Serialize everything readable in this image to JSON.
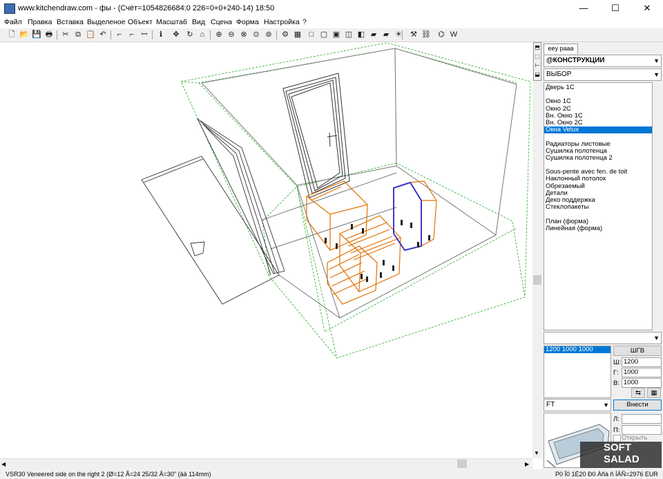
{
  "window": {
    "title": "www.kitchendraw.com - фы - (Счёт=1054826684:0 226=0+0+240-14) 18:50",
    "minimize": "—",
    "maximize": "☐",
    "close": "✕"
  },
  "menu": [
    "Файл",
    "Правка",
    "Вставка",
    "Выделеное",
    "Объект",
    "Масштаб",
    "Вид",
    "Сцена",
    "Форма",
    "Настройка",
    "?"
  ],
  "toolbar_icons": [
    "new-icon",
    "open-icon",
    "save-icon",
    "print-icon",
    "cut-icon",
    "copy-icon",
    "paste-icon",
    "undo-icon",
    "stairs-icon",
    "stairs-edit-icon",
    "measure-icon",
    "info-icon",
    "move-icon",
    "rotate-icon",
    "align-icon",
    "zoom-in-icon",
    "zoom-out-icon",
    "zoom-fit-icon",
    "zoom-window-icon",
    "zoom-prev-icon",
    "render-icon",
    "film-icon",
    "box-icon",
    "plan-icon",
    "view-3d-icon",
    "perspective-icon",
    "iso-icon",
    "camera-icon",
    "camera-multi-icon",
    "light-icon",
    "tools-icon",
    "walk-icon",
    "path-icon",
    "w-icon"
  ],
  "toolbar_glyphs": [
    "🗋",
    "📂",
    "💾",
    "🖶",
    "✂",
    "⧉",
    "📋",
    "↶",
    "⌐",
    "⌐",
    "ꟷ",
    "ℹ",
    "✥",
    "↻",
    "⌂",
    "⊕",
    "⊖",
    "⊗",
    "⊙",
    "⊚",
    "⚙",
    "▦",
    "□",
    "▢",
    "▣",
    "◫",
    "◧",
    "▰",
    "▰",
    "☀",
    "⚒",
    "⛓",
    "⌬",
    "W"
  ],
  "side_tabs": {
    "active_label": "ееу рааа"
  },
  "panel": {
    "category": "@КОНСТРУКЦИИ",
    "filter": "ВЫБОР",
    "items": [
      "Дверь 1С",
      "",
      "Окно 1С",
      "Окно 2С",
      "Вн. Окно 1С",
      "Вн. Окно 2С",
      "Окна Velux",
      "",
      "Радиаторы листовые",
      "Сушилка полотенца",
      "Сушилка полотенца 2",
      "",
      "Sous-pente avec fen. de toit",
      "Наклонный потолок",
      "Обрезаемый",
      "Детали",
      "Деко поддержка",
      "Стеклопакеты",
      "",
      "План (форма)",
      "Линейная (форма)"
    ],
    "selected_index": 6,
    "dims_list": [
      "1200 1000 1000"
    ],
    "dims_button": "ШГВ",
    "w_label": "Ш:",
    "w_value": "1200",
    "d_label": "Г:",
    "d_value": "1000",
    "h_label": "В:",
    "h_value": "1000",
    "finish_combo": "FT",
    "insert_button": "Внести",
    "l_label": "Л:",
    "p_label": "П:",
    "open_checkbox": "Открыть"
  },
  "status": {
    "left": "VSR30  Veneered side on the right 2  (Ø=12 Ã=24 25/32 Â=30\" (ää 114mm)",
    "right": "P0 Î0 1É20 Ð0 Àñà ñ ÍÄÑ=2976 EUR"
  },
  "watermark": "SOFT SALAD"
}
